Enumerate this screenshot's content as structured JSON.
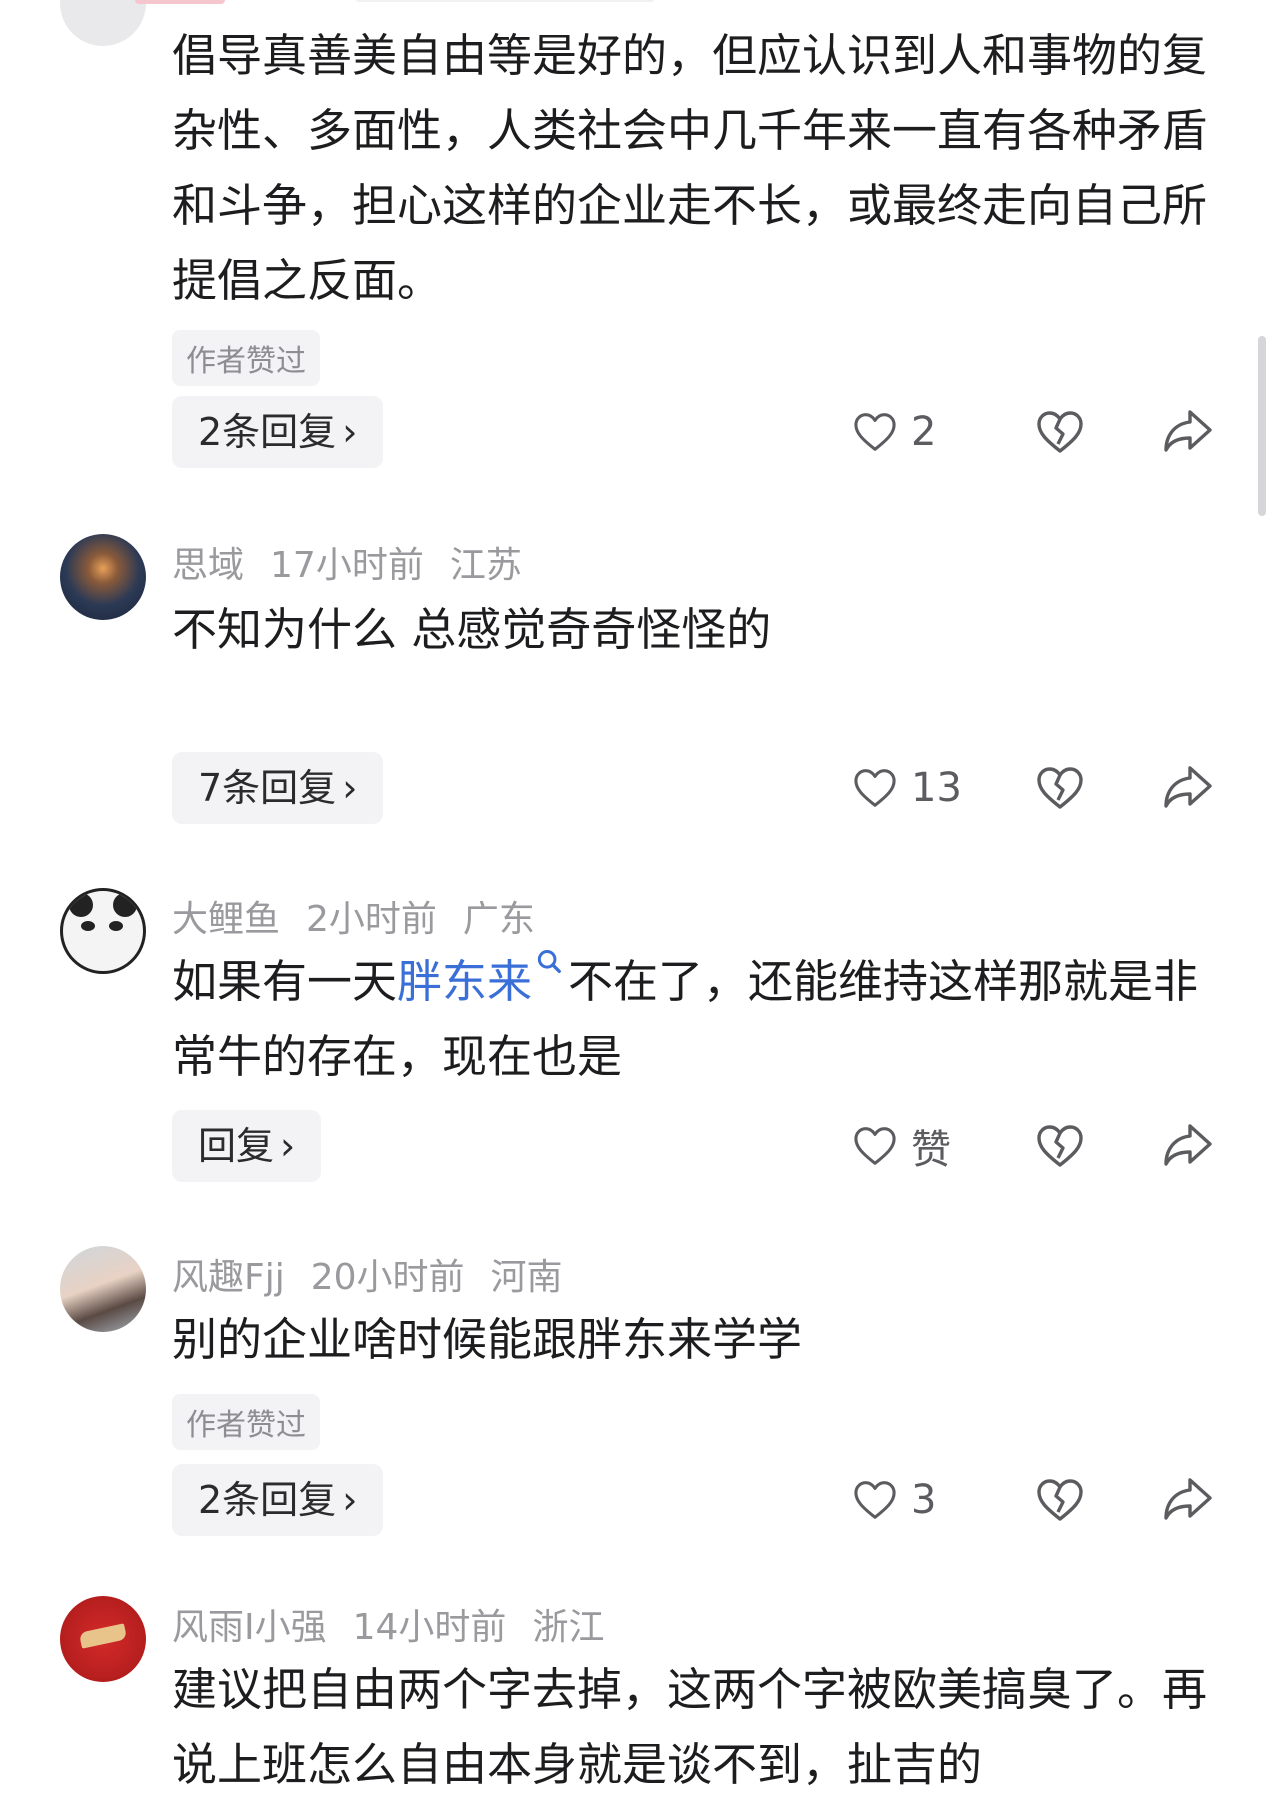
{
  "comments": [
    {
      "text": "倡导真善美自由等是好的，但应认识到人和事物的复杂性、多面性，人类社会中几千年来一直有各种矛盾和斗争，担心这样的企业走不长，或最终走向自己所提倡之反面。",
      "author_liked": "作者赞过",
      "reply_label": "2条回复",
      "like_count": "2"
    },
    {
      "username": "思域",
      "time": "17小时前",
      "location": "江苏",
      "text": "不知为什么 总感觉奇奇怪怪的",
      "reply_label": "7条回复",
      "like_count": "13"
    },
    {
      "username": "大鲤鱼",
      "time": "2小时前",
      "location": "广东",
      "text_before": "如果有一天",
      "text_highlight": "胖东来",
      "text_after": "不在了，还能维持这样那就是非常牛的存在，现在也是",
      "reply_label": "回复",
      "like_count": "赞"
    },
    {
      "username": "风趣Fjj",
      "time": "20小时前",
      "location": "河南",
      "text": "别的企业啥时候能跟胖东来学学",
      "author_liked": "作者赞过",
      "reply_label": "2条回复",
      "like_count": "3"
    },
    {
      "username": "风雨I小强",
      "time": "14小时前",
      "location": "浙江",
      "text": "建议把自由两个字去掉，这两个字被欧美搞臭了。再说上班怎么自由本身就是谈不到，扯吉的"
    }
  ],
  "icons": {
    "like": "heart-icon",
    "dislike": "broken-heart-icon",
    "share": "share-arrow-icon",
    "search": "search-icon",
    "chevron": "chevron-right-icon"
  },
  "colors": {
    "highlight": "#3a6fd8",
    "meta": "#9a9a9e"
  }
}
